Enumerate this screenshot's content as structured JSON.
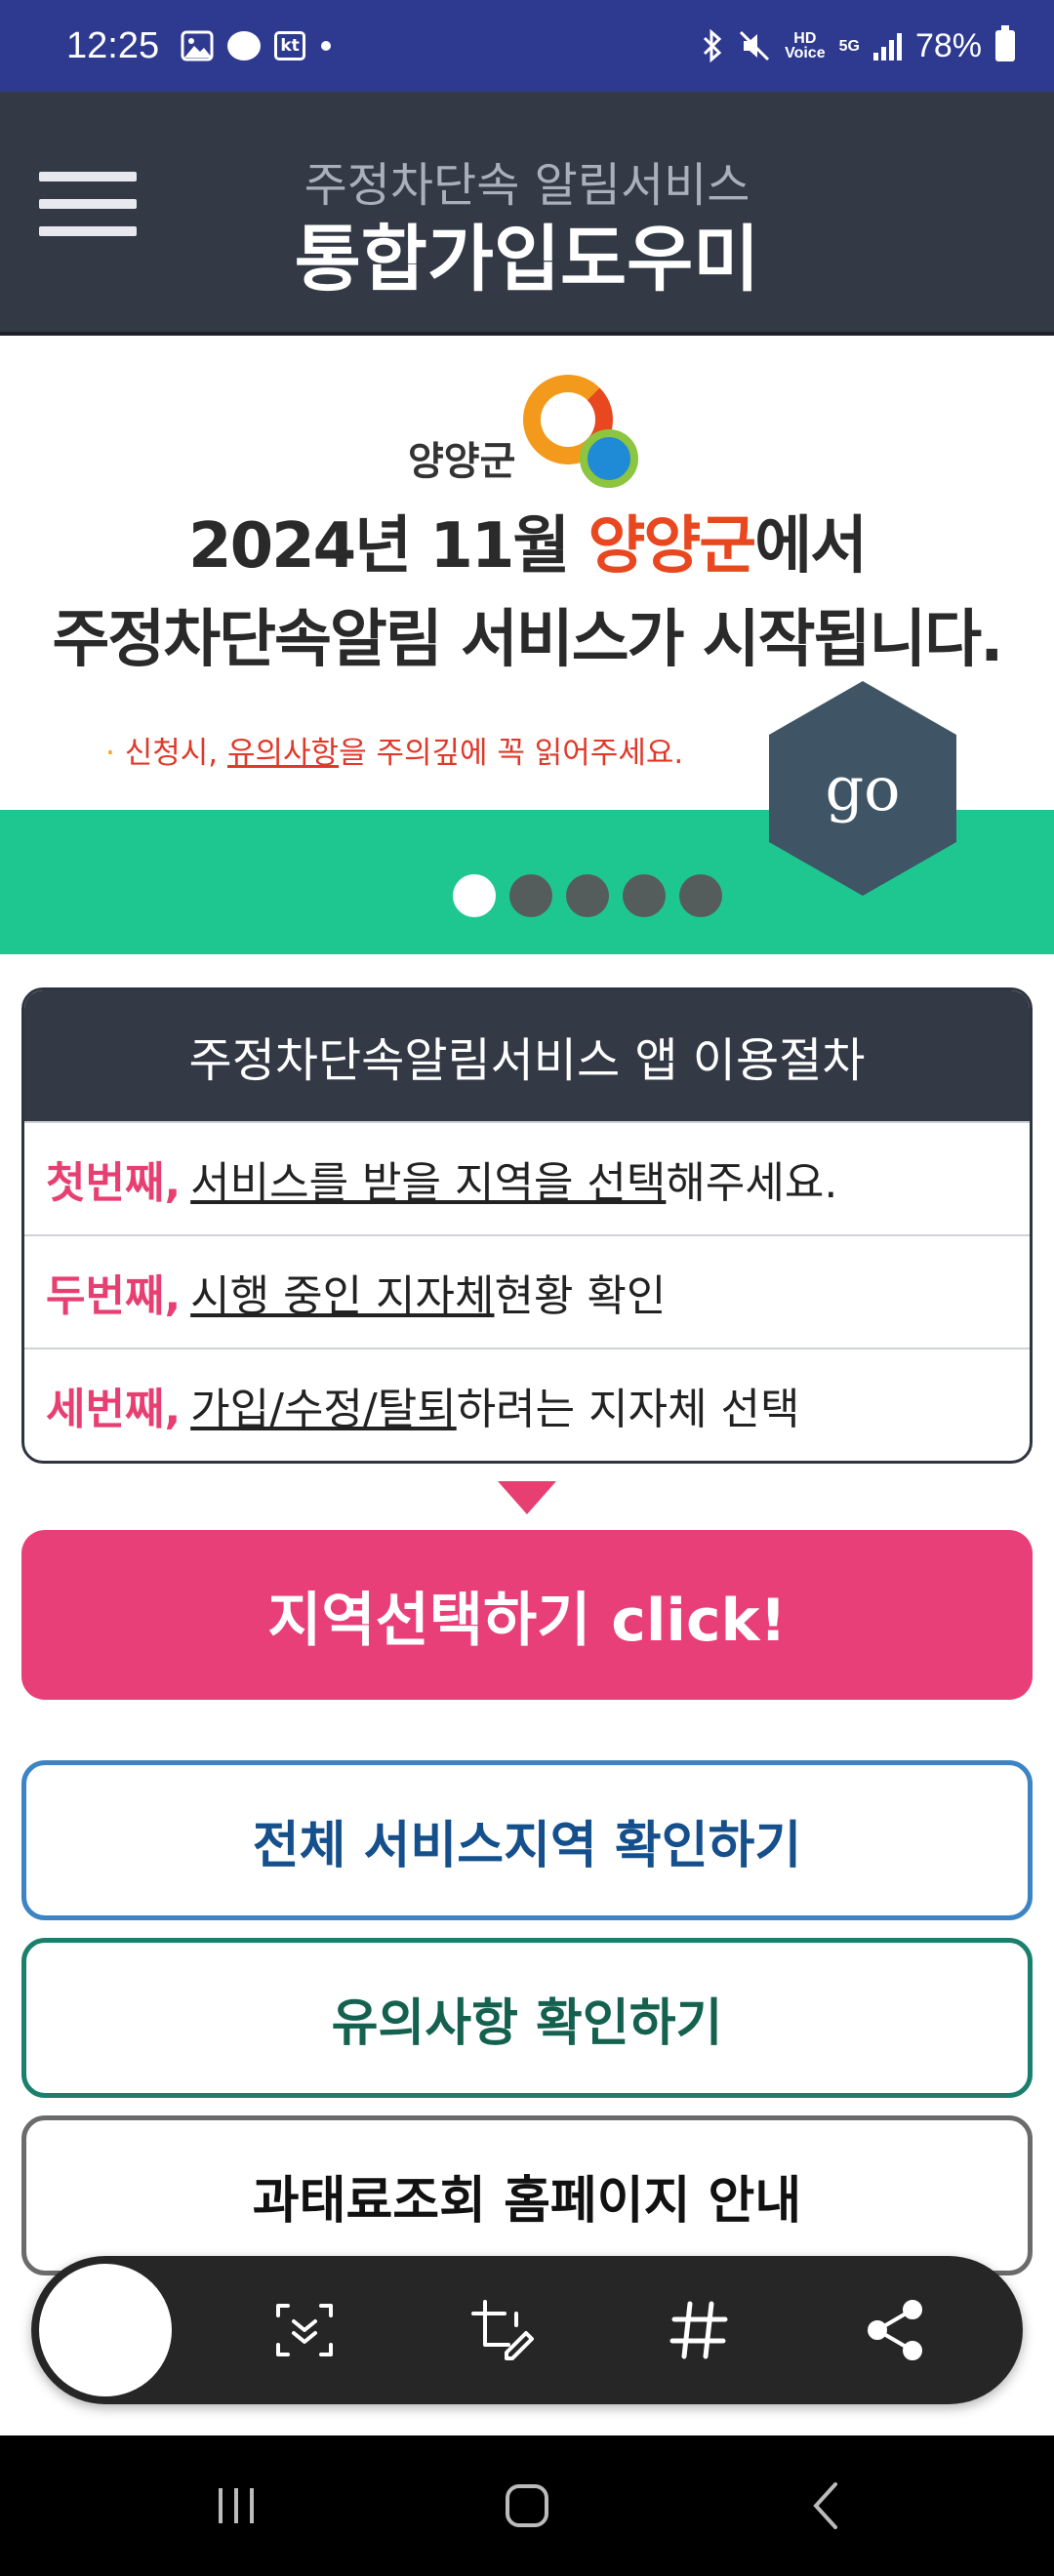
{
  "status_bar": {
    "time": "12:25",
    "carrier_badge": "kt",
    "hd_label_top": "HD",
    "hd_label_bottom": "Voice",
    "network": "5G",
    "battery": "78%",
    "icons": [
      "gallery-icon",
      "chat-bubble-icon",
      "bluetooth-icon",
      "mute-icon",
      "signal-icon",
      "battery-icon"
    ]
  },
  "header": {
    "subtitle": "주정차단속 알림서비스",
    "title": "통합가입도우미"
  },
  "banner": {
    "logo_text": "양양군",
    "headline_year": "2024년 11월 ",
    "headline_region": "양양군",
    "headline_suffix": "에서",
    "headline_line2": "주정차단속알림 서비스가 시작됩니다.",
    "notice_bullet": "·",
    "notice_prefix": " 신청시, ",
    "notice_underlined": "유의사항",
    "notice_suffix": "을 주의깊에 꼭 읽어주세요.",
    "go_label": "go",
    "slides_total": 5,
    "active_slide": 1,
    "colors": {
      "band": "#1fc790",
      "accent": "#e8471f"
    }
  },
  "process": {
    "title": "주정차단속알림서비스 앱 이용절차",
    "steps": [
      {
        "ordinal": "첫번째,",
        "link": "서비스를 받을 지역을 선택",
        "rest": "해주세요."
      },
      {
        "ordinal": "두번째,",
        "link": "시행 중인 지자체",
        "rest": " 현황 확인"
      },
      {
        "ordinal": "세번째,",
        "link": "가입/수정/탈퇴",
        "rest": "하려는 지자체 선택"
      }
    ]
  },
  "buttons": {
    "region_select": "지역선택하기 click!",
    "all_regions": "전체 서비스지역 확인하기",
    "precautions": "유의사항 확인하기",
    "fine_lookup": "과태료조회 홈페이지 안내"
  },
  "colors": {
    "status_bar": "#2e3a8f",
    "header_bg": "#333a45",
    "pink": "#e83f78",
    "blue": "#3c84c4",
    "teal": "#1b7f6d"
  }
}
